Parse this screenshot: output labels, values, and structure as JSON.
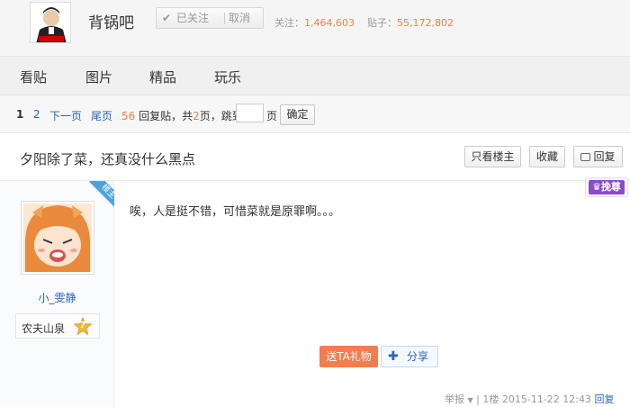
{
  "forum": {
    "name": "背锅吧",
    "follow_status": "已关注",
    "unfollow": "取消",
    "follow_label": "关注：",
    "follow_count": "1,464,603",
    "posts_label": "贴子：",
    "posts_count": "55,172,802"
  },
  "nav": {
    "tabs": [
      "看贴",
      "图片",
      "精品",
      "玩乐"
    ]
  },
  "pager": {
    "current": "1",
    "page2": "2",
    "next": "下一页",
    "last": "尾页",
    "reply_count": "56",
    "reply_label": "回复贴，共",
    "total_pages": "2",
    "pages_label": "页，跳到",
    "page_unit": "页",
    "confirm": "确定"
  },
  "thread": {
    "title": "夕阳除了菜，还真没什么黑点",
    "only_op": "只看楼主",
    "favorite": "收藏",
    "reply": "回复"
  },
  "post": {
    "op_badge": "楼主",
    "username": "小_雯静",
    "level_name": "农夫山泉",
    "level": "7",
    "vip_label": "挽尊",
    "content": "唉，人是挺不错，可惜菜就是原罪啊。。。",
    "gift": "送TA礼物",
    "share": "分享",
    "report": "举报",
    "floor": "1楼",
    "time": "2015-11-22 12:43",
    "reply": "回复"
  },
  "colors": {
    "accent_orange": "#f37d4c",
    "link_blue": "#2d64b3",
    "vip_purple": "#8a4cc8",
    "op_badge_blue": "#4ea3df"
  }
}
